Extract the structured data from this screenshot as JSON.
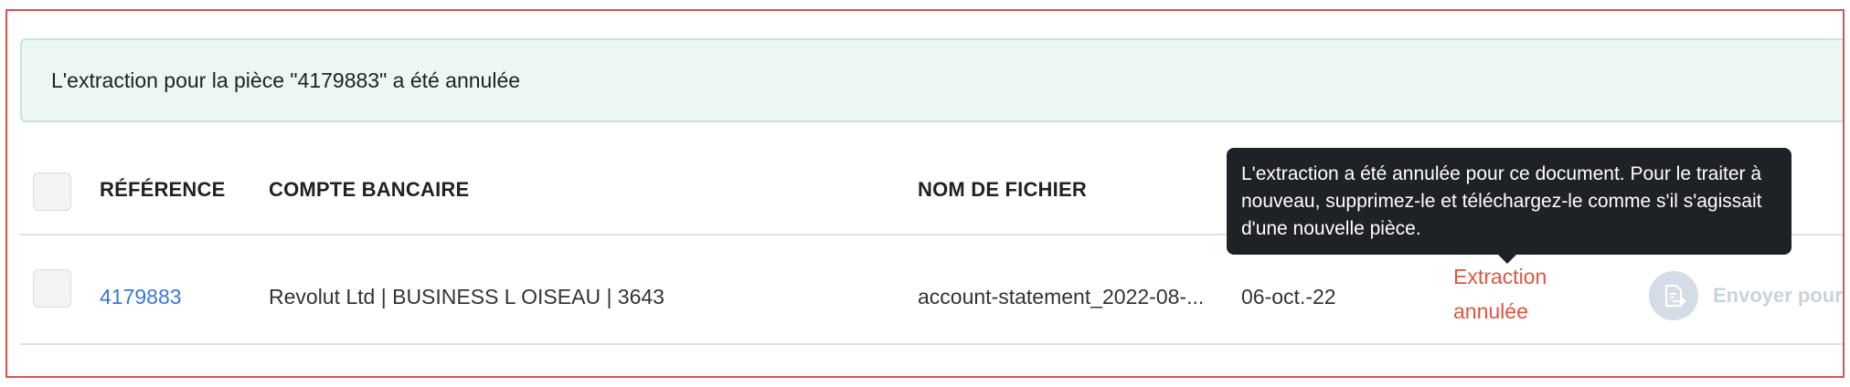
{
  "banner": {
    "message": "L'extraction pour la pièce \"4179883\" a été annulée"
  },
  "table": {
    "headers": {
      "reference": "RÉFÉRENCE",
      "bank_account": "COMPTE BANCAIRE",
      "file_name": "NOM DE FICHIER"
    },
    "rows": [
      {
        "reference": "4179883",
        "bank_account": "Revolut Ltd | BUSINESS L OISEAU | 3643",
        "file_name": "account-statement_2022-08-...",
        "date": "06-oct.-22",
        "status": "Extraction annulée",
        "action_label": "Envoyer pour"
      }
    ]
  },
  "tooltip": {
    "text": "L'extraction a été annulée pour ce document. Pour le traiter à nouveau, supprimez-le et téléchargez-le comme s'il s'agissait d'une nouvelle pièce."
  },
  "colors": {
    "link": "#3b77d8",
    "status_cancelled": "#e0553e",
    "banner_bg": "#ecf6f2",
    "tooltip_bg": "#1e2126"
  },
  "icons": {
    "send": "document-export-icon"
  }
}
